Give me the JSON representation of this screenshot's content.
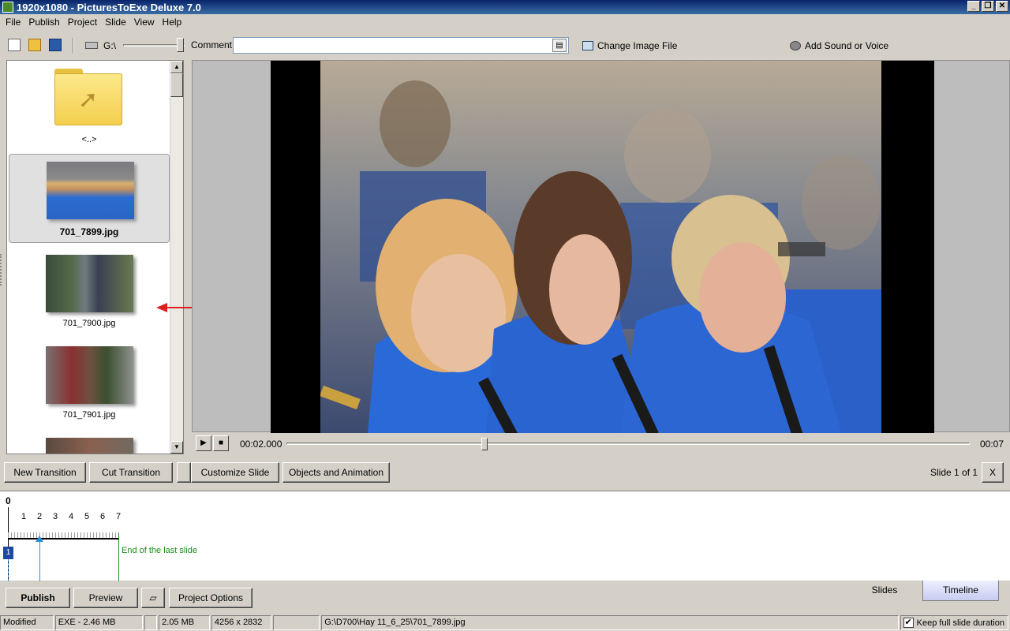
{
  "window": {
    "title": "1920x1080 - PicturesToExe Deluxe 7.0"
  },
  "menu": [
    "File",
    "Publish",
    "Project",
    "Slide",
    "View",
    "Help"
  ],
  "toolbar": {
    "drive": "G:\\",
    "comment_label": "Comment",
    "comment_value": "",
    "change_image": "Change Image File",
    "add_sound": "Add Sound or Voice"
  },
  "files": {
    "parent": "<..>",
    "items": [
      {
        "name": "701_7899.jpg",
        "selected": true
      },
      {
        "name": "701_7900.jpg",
        "selected": false
      },
      {
        "name": "701_7901.jpg",
        "selected": false
      }
    ]
  },
  "player": {
    "current_time": "00:02.000",
    "total_time": "00:07",
    "position": 0.29
  },
  "buttons": {
    "new_transition": "New Transition",
    "cut_transition": "Cut Transition",
    "customize_slide": "Customize Slide",
    "objects_animation": "Objects and Animation",
    "close": "X",
    "slide_counter": "Slide 1 of 1"
  },
  "timeline": {
    "zero": "0",
    "ticks": [
      "1",
      "2",
      "3",
      "4",
      "5",
      "6",
      "7"
    ],
    "end_label": "End of the last slide",
    "slide_number": "1"
  },
  "bottom": {
    "publish": "Publish",
    "preview": "Preview",
    "project_options": "Project Options",
    "tab_slides": "Slides",
    "tab_timeline": "Timeline"
  },
  "status": {
    "state": "Modified",
    "exe": "EXE - 2.46 MB",
    "size": "2.05 MB",
    "dimensions": "4256 x 2832",
    "path": "G:\\D700\\Hay 11_6_25\\701_7899.jpg",
    "keep_duration": "Keep full slide duration",
    "keep_checked": true
  }
}
